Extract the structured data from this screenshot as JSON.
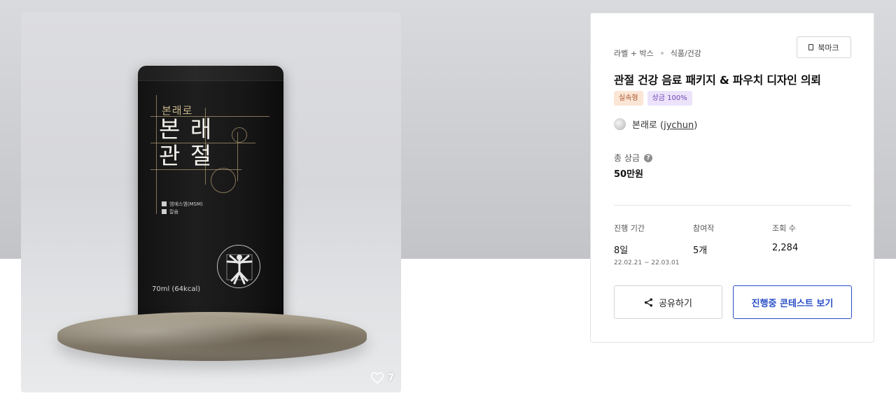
{
  "product_image": {
    "brand_small": "본래로",
    "title_line1": "본 래",
    "title_line2": "관 절",
    "check_items": [
      "엠에스엠(MSM)",
      "칼슘"
    ],
    "volume": "70ml (64kcal)",
    "likes": "7"
  },
  "contest": {
    "breadcrumb": [
      "라벨 + 박스",
      "식품/건강"
    ],
    "bookmark_label": "북마크",
    "title": "관절 건강 음료 패키지 & 파우치 디자인 의뢰",
    "badges": [
      "실속형",
      "상금 100%"
    ],
    "owner_name": "본래로",
    "owner_id_open": "(",
    "owner_id": "jychun",
    "owner_id_close": ")",
    "prize_label": "총 상금",
    "prize_value": "50만원",
    "stats": [
      {
        "label": "진행 기간",
        "value": "8일",
        "sub": "22.02.21  ~  22.03.01"
      },
      {
        "label": "참여작",
        "value": "5개",
        "sub": ""
      },
      {
        "label": "조회 수",
        "value": "2,284",
        "sub": ""
      }
    ],
    "share_label": "공유하기",
    "ongoing_label": "진행중 콘테스트 보기"
  },
  "colors": {
    "accent": "#2a4fc7",
    "badge_practical_bg": "#fbe5d5",
    "badge_prize_bg": "#ece3fb"
  },
  "icons": [
    "heart-icon",
    "bookmark-icon",
    "help-icon",
    "share-icon"
  ]
}
